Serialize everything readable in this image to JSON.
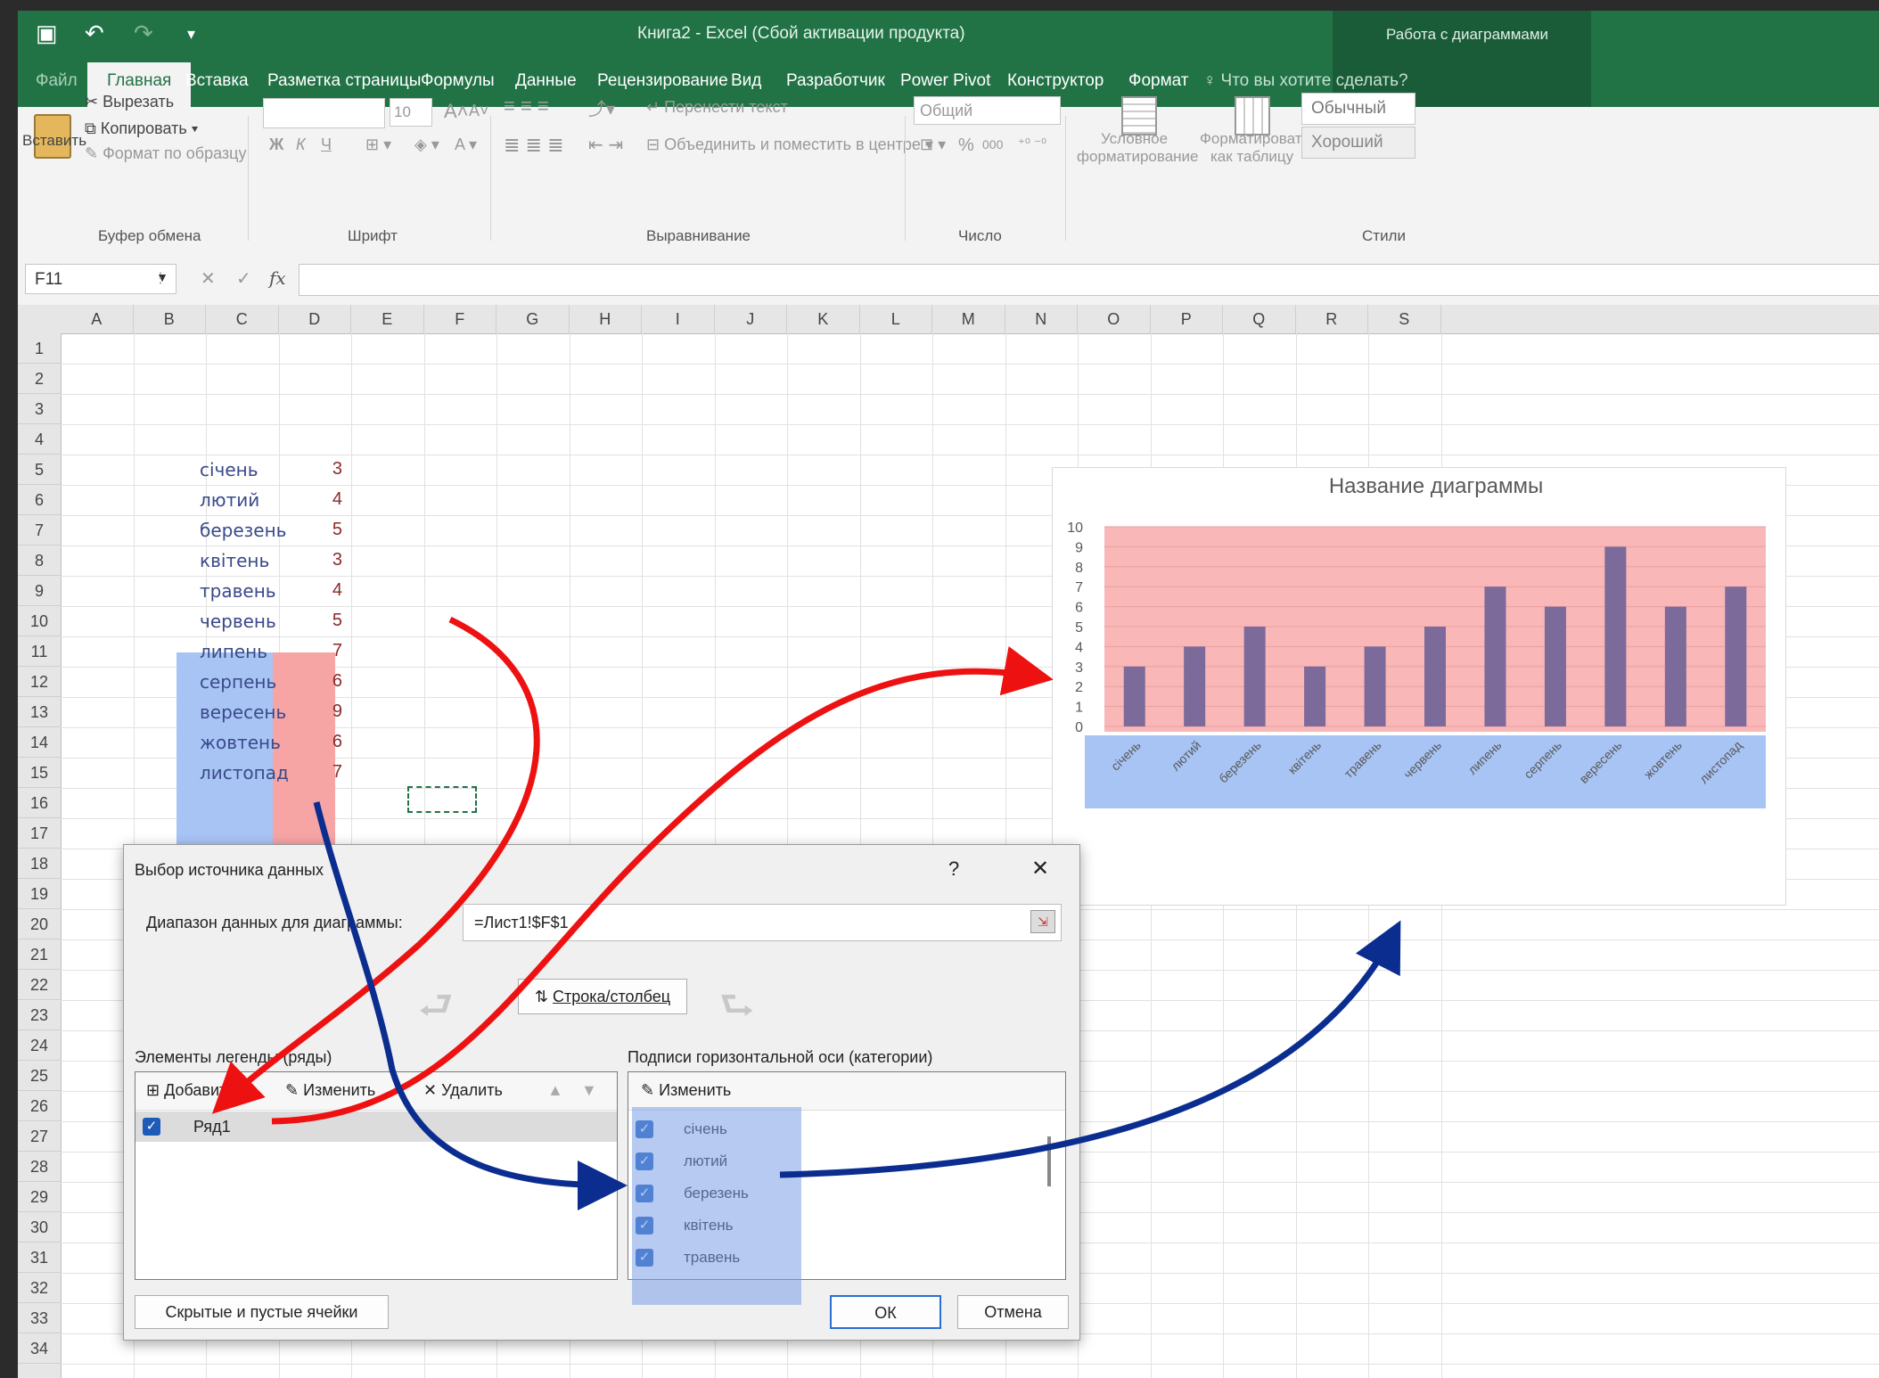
{
  "window": {
    "title": "Книга2 - Excel (Сбой активации продукта)",
    "context_group": "Работа с диаграммами"
  },
  "tabs": [
    "Файл",
    "Главная",
    "Вставка",
    "Разметка страницы",
    "Формулы",
    "Данные",
    "Рецензирование",
    "Вид",
    "Разработчик",
    "Power Pivot",
    "Конструктор",
    "Формат"
  ],
  "tell_me": "Что вы хотите сделать?",
  "ribbon": {
    "clipboard": {
      "paste": "Вставить",
      "cut": "Вырезать",
      "copy": "Копировать",
      "format_painter": "Формат по образцу",
      "label": "Буфер обмена"
    },
    "font": {
      "size": "10",
      "bold": "Ж",
      "italic": "К",
      "underline": "Ч",
      "label": "Шрифт"
    },
    "alignment": {
      "wrap": "Перенести текст",
      "merge": "Объединить и поместить в центре",
      "label": "Выравнивание"
    },
    "number": {
      "format": "Общий",
      "percent": "%",
      "thousands": "000",
      "label": "Число"
    },
    "styles": {
      "conditional": "Условное",
      "conditional2": "форматирование",
      "as_table": "Форматировать",
      "as_table2": "как таблицу",
      "normal": "Обычный",
      "good": "Хороший",
      "label": "Стили"
    }
  },
  "formula_bar": {
    "name_box": "F11",
    "fx": "fx",
    "value": ""
  },
  "columns": [
    "A",
    "B",
    "C",
    "D",
    "E",
    "F",
    "G",
    "H",
    "I",
    "J",
    "K",
    "L",
    "M",
    "N",
    "O",
    "P",
    "Q",
    "R",
    "S"
  ],
  "rows": [
    "1",
    "2",
    "3",
    "4",
    "5",
    "6",
    "7",
    "8",
    "9",
    "10",
    "11",
    "12",
    "13",
    "14",
    "15",
    "16",
    "17",
    "18",
    "19",
    "20",
    "21",
    "22",
    "23",
    "24",
    "25",
    "26",
    "27",
    "28",
    "29",
    "30",
    "31",
    "32",
    "33",
    "34"
  ],
  "sheet_data": {
    "months": [
      "січень",
      "лютий",
      "березень",
      "квітень",
      "травень",
      "червень",
      "липень",
      "серпень",
      "вересень",
      "жовтень",
      "листопад"
    ],
    "values": [
      "3",
      "4",
      "5",
      "3",
      "4",
      "5",
      "7",
      "6",
      "9",
      "6",
      "7"
    ]
  },
  "chart_data": {
    "type": "bar",
    "title": "Название диаграммы",
    "categories": [
      "січень",
      "лютий",
      "березень",
      "квітень",
      "травень",
      "червень",
      "липень",
      "серпень",
      "вересень",
      "жовтень",
      "листопад"
    ],
    "series": [
      {
        "values": [
          3,
          4,
          5,
          3,
          4,
          5,
          7,
          6,
          9,
          6,
          7
        ]
      }
    ],
    "ylim": [
      0,
      10
    ],
    "yticks": [
      "0",
      "1",
      "2",
      "3",
      "4",
      "5",
      "6",
      "7",
      "8",
      "9",
      "10"
    ],
    "grid": true,
    "bar_color": "#7b6a9a"
  },
  "dialog": {
    "title": "Выбор источника данных",
    "help": "?",
    "close": "✕",
    "range_label": "Диапазон данных для диаграммы:",
    "range_value": "=Лист1!$F$1",
    "switch_button": "Строка/столбец",
    "legend_label": "Элементы легенды (ряды)",
    "add": "Добавить",
    "edit": "Изменить",
    "delete": "Удалить",
    "series": [
      "Ряд1"
    ],
    "axis_label": "Подписи горизонтальной оси (категории)",
    "axis_edit": "Изменить",
    "axis_items": [
      "січень",
      "лютий",
      "березень",
      "квітень",
      "травень"
    ],
    "hidden_cells": "Скрытые и пустые ячейки",
    "ok": "ОК",
    "cancel": "Отмена"
  },
  "colors": {
    "excel_green": "#217346",
    "highlight_blue": "#a8c4f5",
    "highlight_red": "#f6a4a4",
    "arrow_red": "#ee1111",
    "arrow_blue": "#0a2d8f"
  }
}
